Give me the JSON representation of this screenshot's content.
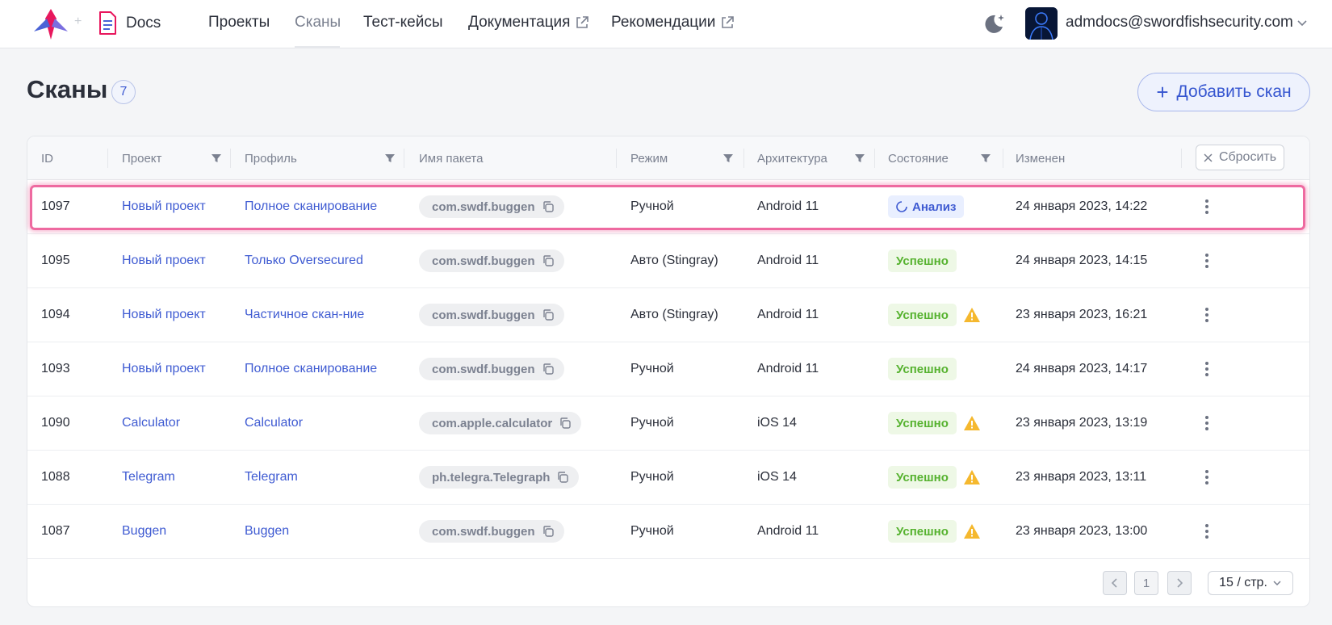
{
  "header": {
    "app_label": "Docs",
    "nav": [
      {
        "label": "Проекты",
        "active": false,
        "external": false
      },
      {
        "label": "Сканы",
        "active": true,
        "external": false
      },
      {
        "label": "Тест-кейсы",
        "active": false,
        "external": false
      },
      {
        "label": "Документация",
        "active": false,
        "external": true
      },
      {
        "label": "Рекомендации",
        "active": false,
        "external": true
      }
    ],
    "user_email": "admdocs@swordfishsecurity.com"
  },
  "page": {
    "title": "Сканы",
    "count": "7",
    "add_button": "Добавить скан"
  },
  "table": {
    "columns": [
      "ID",
      "Проект",
      "Профиль",
      "Имя пакета",
      "Режим",
      "Архитектура",
      "Состояние",
      "Изменен"
    ],
    "reset_label": "Сбросить",
    "rows": [
      {
        "id": "1097",
        "project": "Новый проект",
        "profile": "Полное сканирование",
        "package": "com.swdf.buggen",
        "mode": "Ручной",
        "arch": "Android 11",
        "status": "Анализ",
        "status_type": "running",
        "warning": false,
        "modified": "24 января 2023, 14:22"
      },
      {
        "id": "1095",
        "project": "Новый проект",
        "profile": "Только Oversecured",
        "package": "com.swdf.buggen",
        "mode": "Авто (Stingray)",
        "arch": "Android 11",
        "status": "Успешно",
        "status_type": "success",
        "warning": false,
        "modified": "24 января 2023, 14:15"
      },
      {
        "id": "1094",
        "project": "Новый проект",
        "profile": "Частичное скан-ние",
        "package": "com.swdf.buggen",
        "mode": "Авто (Stingray)",
        "arch": "Android 11",
        "status": "Успешно",
        "status_type": "success",
        "warning": true,
        "modified": "23 января 2023, 16:21"
      },
      {
        "id": "1093",
        "project": "Новый проект",
        "profile": "Полное сканирование",
        "package": "com.swdf.buggen",
        "mode": "Ручной",
        "arch": "Android 11",
        "status": "Успешно",
        "status_type": "success",
        "warning": false,
        "modified": "24 января 2023, 14:17"
      },
      {
        "id": "1090",
        "project": "Calculator",
        "profile": "Calculator",
        "package": "com.apple.calculator",
        "mode": "Ручной",
        "arch": "iOS 14",
        "status": "Успешно",
        "status_type": "success",
        "warning": true,
        "modified": "23 января 2023, 13:19"
      },
      {
        "id": "1088",
        "project": "Telegram",
        "profile": "Telegram",
        "package": "ph.telegra.Telegraph",
        "mode": "Ручной",
        "arch": "iOS 14",
        "status": "Успешно",
        "status_type": "success",
        "warning": true,
        "modified": "23 января 2023, 13:11"
      },
      {
        "id": "1087",
        "project": "Buggen",
        "profile": "Buggen",
        "package": "com.swdf.buggen",
        "mode": "Ручной",
        "arch": "Android 11",
        "status": "Успешно",
        "status_type": "success",
        "warning": true,
        "modified": "23 января 2023, 13:00"
      }
    ]
  },
  "pagination": {
    "current_page": "1",
    "page_size": "15 / стр."
  },
  "colors": {
    "accent": "#3f5bd2",
    "success": "#56b22f",
    "warning": "#f5b82e",
    "highlight": "#ee6aa0"
  },
  "icons": [
    "logo-icon",
    "docs-icon",
    "external-link-icon",
    "moon-icon",
    "chevron-down-icon",
    "filter-icon",
    "close-icon",
    "copy-icon",
    "spinner-icon",
    "warning-icon",
    "kebab-menu-icon",
    "chevron-left-icon",
    "chevron-right-icon"
  ]
}
